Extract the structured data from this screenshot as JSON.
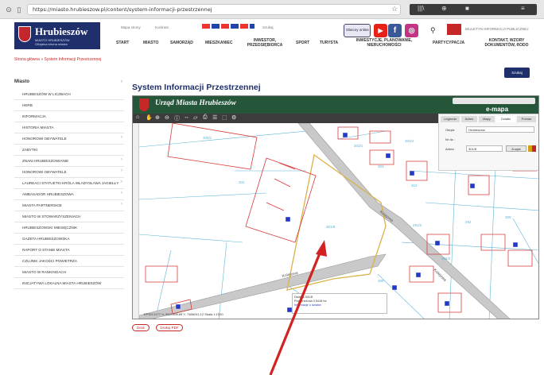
{
  "browser": {
    "url": "https://miasto.hrubieszow.pl/content/system-informacji-przestrzennej",
    "tools_labels": [
      "|||\\",
      "⊕",
      "■",
      "≡"
    ]
  },
  "header": {
    "logo_title": "Hrubieszów",
    "logo_sub": "MIASTO HRUBIESZÓW",
    "logo_sub2": "Oficjalna strona miasta",
    "top_mini": [
      "Mapa strony",
      "Kontrast",
      "Szukaj"
    ],
    "nav": [
      "START",
      "MIASTO",
      "SAMORZĄD",
      "MIESZKANIEC",
      "INWESTOR, PRZEDSIĘBIORCA",
      "SPORT",
      "TURYSTA",
      "INWESTYCJE, PLANOWANIE, NIERUCHOMOŚCI",
      "PARTYCYPACJA",
      "KONTAKT, WZORY DOKUMENTÓW, RODO"
    ],
    "obecny_label": "Obecny online",
    "bip_text": "BIULETYN INFORMACJI PUBLICZNEJ"
  },
  "breadcrumb": "Strona główna  »  System Informacji Przestrzennej",
  "search_label": "Szukaj",
  "sidebar": {
    "title": "Miasto",
    "items": [
      "HRUBIESZÓW W LICZBACH",
      "HERB",
      "INFORMACJA",
      "HISTORIA MIASTA",
      "HONOROWI OBYWATELE",
      "ZABYTKI",
      "ZNANI HRUBIESZOWIANIE",
      "HONOROWI OBYWATELE",
      "LAUREACI STATUETKI KRÓLA WŁADYSŁAWA JAGIEŁŁY",
      "AMBASADOR HRUBIESZOWA",
      "MIASTA PARTNERSKIE",
      "MIASTO W STOWARZYSZENIACH",
      "HRUBIESZOWSKI MIESIĘCZNIK",
      "GAZETA HRUBIESZOWSKA",
      "RAPORT O STANIE MIASTA",
      "CZUJNIK JAKOŚCI POWIETRZA",
      "MIASTO W RANKINGACH",
      "INICJATYWA LOKALNA MIASTA HRUBIESZÓW"
    ]
  },
  "page_title": "System Informacji Przestrzennej",
  "map": {
    "title": "Urząd Miasta Hrubieszów",
    "brand": "e-mapa",
    "panel_tabs": [
      "Legenda",
      "Adres",
      "Mapy",
      "Działki",
      "Pomiar"
    ],
    "panel_labels": [
      "Obręb:",
      "Nr dz.:",
      "Adres:"
    ],
    "panel_values": [
      "Hrubieszów",
      "301/8"
    ],
    "panel_button": "Znajdź",
    "parcel_label": "301/8",
    "street_label": "Kolejowa",
    "info_lines": [
      "Działka 301/8",
      "Powierzchnia 0,5418 ha",
      "Informacje o działce"
    ],
    "footer": "EPSG:2177 X: 5621308.89  Y: 7488241.12  Skala 1:1000",
    "parcel_labels": [
      "300/1",
      "302",
      "303/1",
      "304/2",
      "310",
      "311/4",
      "303",
      "291/2",
      "292",
      "306/3",
      "309",
      "308"
    ]
  },
  "bottom_buttons": [
    "Druk",
    "Drukuj PDF"
  ],
  "colors": {
    "navy": "#1f2f6b",
    "map_green": "#25563a",
    "accent_red": "#c62828",
    "parcel_yellow": "#d9b24a",
    "building_red": "#d83a3a"
  }
}
